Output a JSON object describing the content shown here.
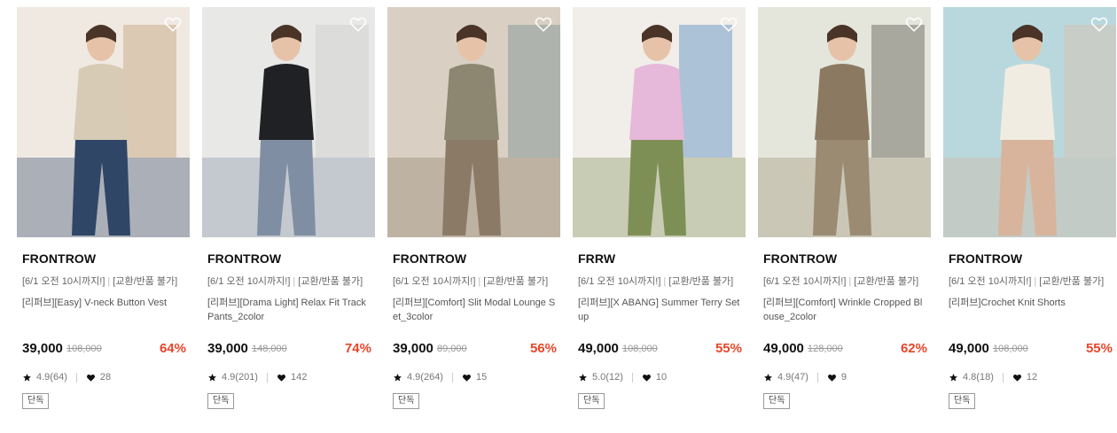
{
  "products": [
    {
      "brand": "FRONTROW",
      "notice_left": "[6/1 오전 10시까지!]",
      "notice_right": "[교환/반품 불가]",
      "name": "[리퍼브][Easy] V-neck Button Vest",
      "price": "39,000",
      "original_price": "108,000",
      "discount": "64%",
      "rating": "4.9(64)",
      "likes": "28",
      "badge": "단독",
      "photo": {
        "bg": "#efe9e2",
        "accent": "#b98e5c",
        "figure": "#d8cbb5",
        "bottom": "#2f4667"
      }
    },
    {
      "brand": "FRONTROW",
      "notice_left": "[6/1 오전 10시까지!]",
      "notice_right": "[교환/반품 불가]",
      "name": "[리퍼브][Drama Light] Relax Fit Track Pants_2color",
      "price": "39,000",
      "original_price": "148,000",
      "discount": "74%",
      "rating": "4.9(201)",
      "likes": "142",
      "badge": "단독",
      "photo": {
        "bg": "#e8e8e6",
        "accent": "#c7c7c4",
        "figure": "#1f2125",
        "bottom": "#7f8ea3"
      }
    },
    {
      "brand": "FRONTROW",
      "notice_left": "[6/1 오전 10시까지!]",
      "notice_right": "[교환/반품 불가]",
      "name": "[리퍼브][Comfort] Slit Modal Lounge Set_3color",
      "price": "39,000",
      "original_price": "89,000",
      "discount": "56%",
      "rating": "4.9(264)",
      "likes": "15",
      "badge": "단독",
      "photo": {
        "bg": "#d9cfc3",
        "accent": "#5f7f85",
        "figure": "#8d8670",
        "bottom": "#8b7b66"
      }
    },
    {
      "brand": "FRRW",
      "notice_left": "[6/1 오전 10시까지!]",
      "notice_right": "[교환/반품 불가]",
      "name": "[리퍼브][X ABANG] Summer Terry Set up",
      "price": "49,000",
      "original_price": "108,000",
      "discount": "55%",
      "rating": "5.0(12)",
      "likes": "10",
      "badge": "단독",
      "photo": {
        "bg": "#f1ede9",
        "accent": "#2c73b8",
        "figure": "#e6b8d9",
        "bottom": "#7e8f56"
      }
    },
    {
      "brand": "FRONTROW",
      "notice_left": "[6/1 오전 10시까지!]",
      "notice_right": "[교환/반품 불가]",
      "name": "[리퍼브][Comfort] Wrinkle Cropped Blouse_2color",
      "price": "49,000",
      "original_price": "128,000",
      "discount": "62%",
      "rating": "4.9(47)",
      "likes": "9",
      "badge": "단독",
      "photo": {
        "bg": "#e4e6dc",
        "accent": "#3c332c",
        "figure": "#8b7a61",
        "bottom": "#9b8b72"
      }
    },
    {
      "brand": "FRONTROW",
      "notice_left": "[6/1 오전 10시까지!]",
      "notice_right": "[교환/반품 불가]",
      "name": "[리퍼브]Crochet Knit Shorts",
      "price": "49,000",
      "original_price": "108,000",
      "discount": "55%",
      "rating": "4.8(18)",
      "likes": "12",
      "badge": "단독",
      "photo": {
        "bg": "#b9d8de",
        "accent": "#e9b99e",
        "figure": "#f1ece1",
        "bottom": "#d8b49c"
      }
    }
  ],
  "colors": {
    "discount": "#e8462a",
    "brand_text": "#111111",
    "muted_text": "#777777"
  },
  "icons": {
    "wishlist": "heart-outline-icon",
    "rating": "star-icon",
    "likes": "heart-filled-icon"
  }
}
